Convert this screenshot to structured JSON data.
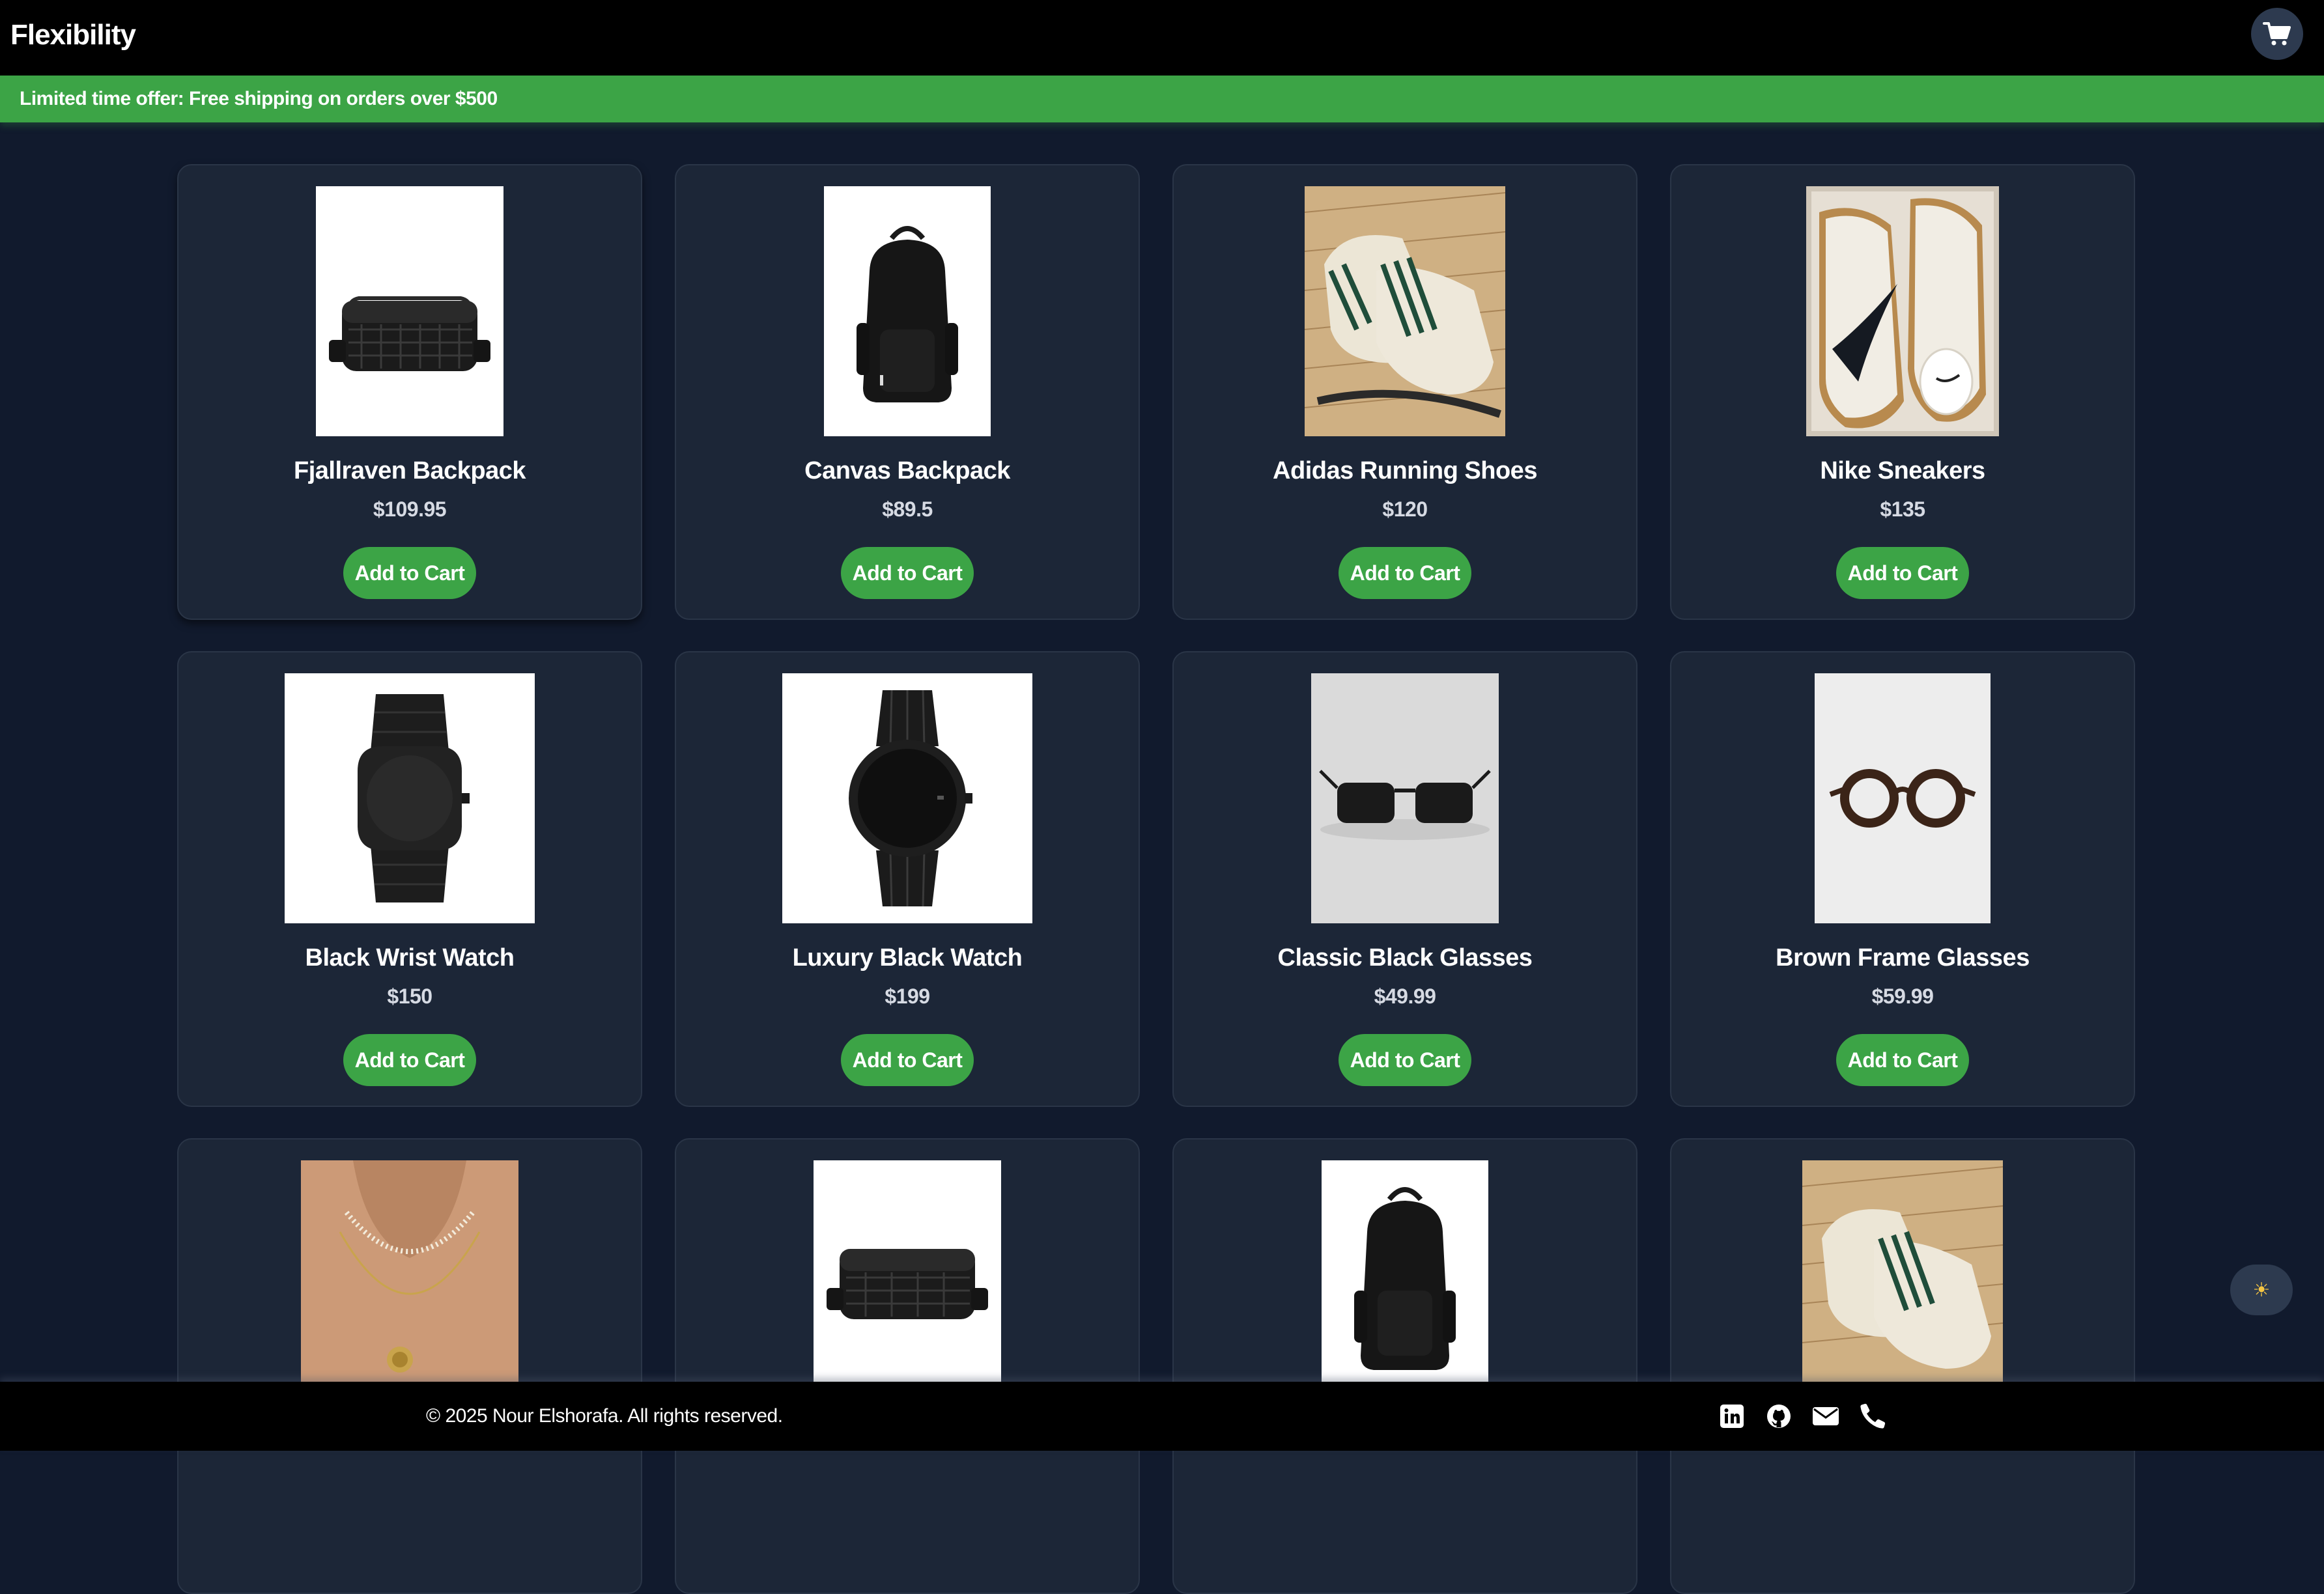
{
  "header": {
    "brand": "Flexibility",
    "cart_icon": "shopping-cart-icon"
  },
  "promo": {
    "text": "Limited time offer: Free shipping on orders over $500"
  },
  "products": [
    {
      "name": "Fjallraven Backpack",
      "price": "$109.95",
      "button": "Add to Cart",
      "image": "black-crossbody-bag"
    },
    {
      "name": "Canvas Backpack",
      "price": "$89.5",
      "button": "Add to Cart",
      "image": "black-backpack"
    },
    {
      "name": "Adidas Running Shoes",
      "price": "$120",
      "button": "Add to Cart",
      "image": "white-green-sneakers"
    },
    {
      "name": "Nike Sneakers",
      "price": "$135",
      "button": "Add to Cart",
      "image": "white-swoosh-sneakers"
    },
    {
      "name": "Black Wrist Watch",
      "price": "$150",
      "button": "Add to Cart",
      "image": "black-watch"
    },
    {
      "name": "Luxury Black Watch",
      "price": "$199",
      "button": "Add to Cart",
      "image": "black-luxury-watch"
    },
    {
      "name": "Classic Black Glasses",
      "price": "$49.99",
      "button": "Add to Cart",
      "image": "black-sunglasses"
    },
    {
      "name": "Brown Frame Glasses",
      "price": "$59.99",
      "button": "Add to Cart",
      "image": "brown-frame-glasses"
    },
    {
      "image": "pearl-necklace"
    },
    {
      "image": "black-crossbody-bag"
    },
    {
      "image": "black-backpack"
    },
    {
      "image": "white-green-sneakers"
    }
  ],
  "theme_toggle": {
    "icon": "sun-icon",
    "glyph": "☀"
  },
  "footer": {
    "copyright": "© 2025 Nour Elshorafa. All rights reserved.",
    "social": [
      "linkedin-icon",
      "github-icon",
      "mail-icon",
      "phone-icon"
    ]
  },
  "colors": {
    "background": "#111a2d",
    "card": "#1c2637",
    "accent": "#3ca446",
    "header": "#000000"
  }
}
